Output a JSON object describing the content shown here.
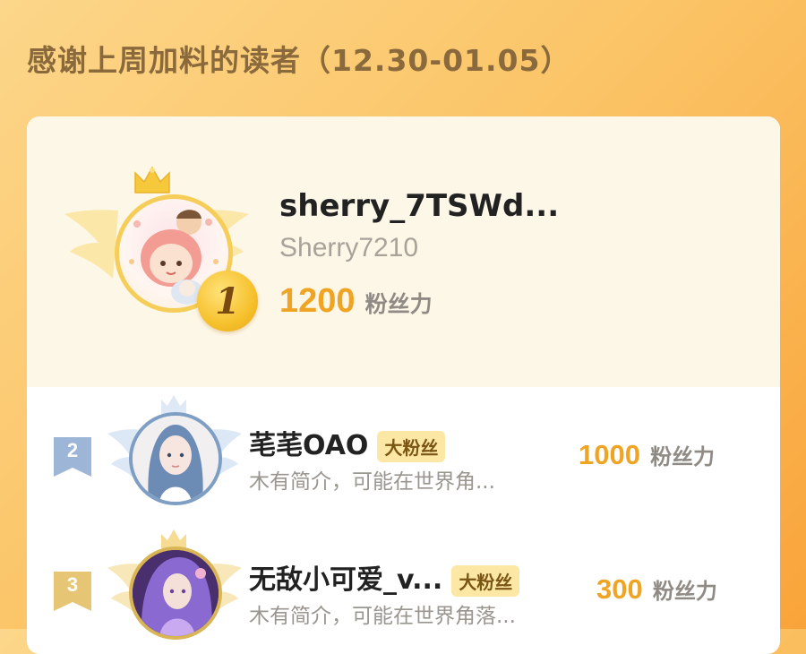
{
  "header": {
    "title": "感谢上周加料的读者（12.30-01.05）"
  },
  "first": {
    "rank": "1",
    "name": "sherry_7TSWd...",
    "handle": "Sherry7210",
    "score": "1200",
    "unit": "粉丝力"
  },
  "rows": [
    {
      "rank": "2",
      "name": "芼芼OAO",
      "tag": "大粉丝",
      "bio": "木有简介，可能在世界角...",
      "score": "1000",
      "unit": "粉丝力"
    },
    {
      "rank": "3",
      "name": "无敌小可爱_v...",
      "tag": "大粉丝",
      "bio": "木有简介，可能在世界角落...",
      "score": "300",
      "unit": "粉丝力"
    }
  ],
  "colors": {
    "gold": "#f0a424",
    "silver": "#9db6d8",
    "bronze": "#e6c674",
    "tag_bg": "#fde7a4"
  },
  "icons": [
    "crown-icon",
    "wings-icon",
    "rank-ribbon-icon"
  ]
}
